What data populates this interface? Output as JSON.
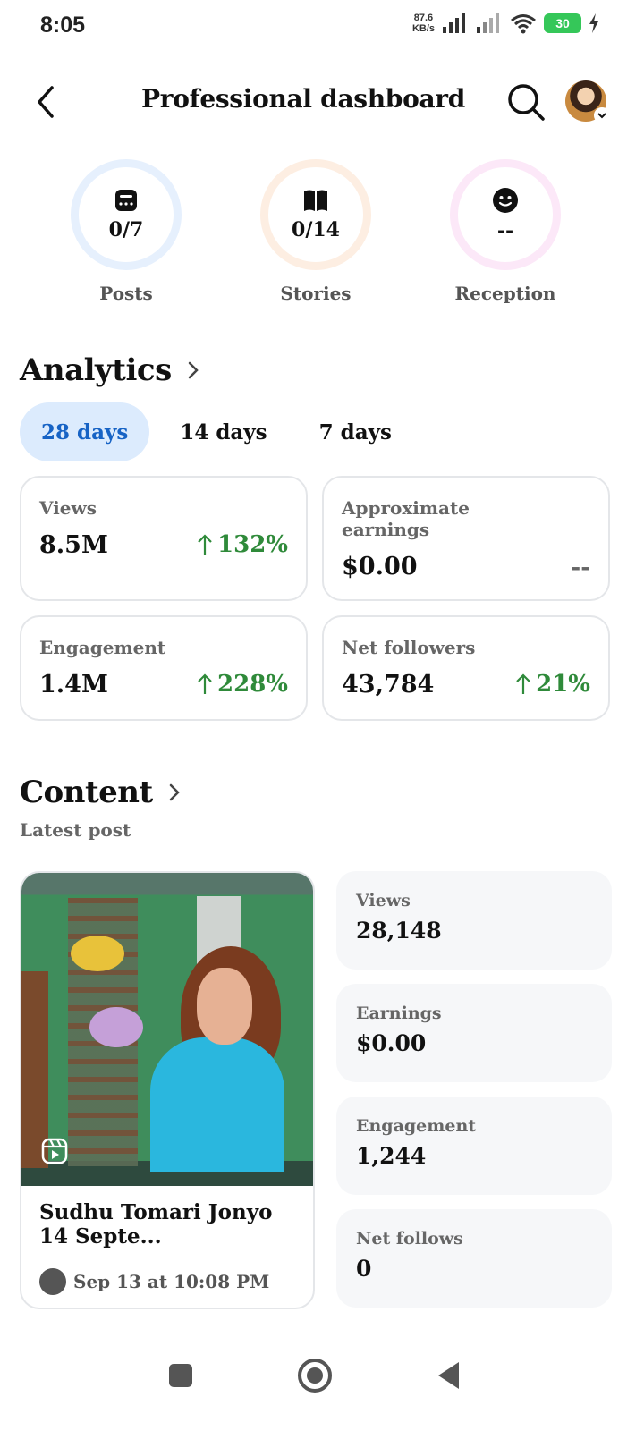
{
  "status_bar": {
    "time": "8:05",
    "net_speed_value": "87.6",
    "net_speed_unit": "KB/s",
    "battery": "30"
  },
  "header": {
    "title": "Professional dashboard"
  },
  "goals": [
    {
      "value": "0/7",
      "label": "Posts",
      "ring_color": "#e6f0fd",
      "icon": "post-icon"
    },
    {
      "value": "0/14",
      "label": "Stories",
      "ring_color": "#fdeee2",
      "icon": "book-icon"
    },
    {
      "value": "--",
      "label": "Reception",
      "ring_color": "#fce8f8",
      "icon": "smiley-icon"
    }
  ],
  "analytics": {
    "title": "Analytics",
    "ranges": [
      "28 days",
      "14 days",
      "7 days"
    ],
    "active_range": "28 days",
    "cards": [
      {
        "label": "Views",
        "value": "8.5M",
        "change": "132%"
      },
      {
        "label": "Approximate earnings",
        "value": "$0.00",
        "change": "--"
      },
      {
        "label": "Engagement",
        "value": "1.4M",
        "change": "228%"
      },
      {
        "label": "Net followers",
        "value": "43,784",
        "change": "21%"
      }
    ],
    "accent_color": "#1763c5",
    "positive_color": "#2f8a3a"
  },
  "content": {
    "title": "Content",
    "latest_label": "Latest post",
    "post": {
      "title": "Sudhu Tomari Jonyo 14 Septe...",
      "date": "Sep 13 at 10:08 PM"
    },
    "stats": [
      {
        "label": "Views",
        "value": "28,148"
      },
      {
        "label": "Earnings",
        "value": "$0.00"
      },
      {
        "label": "Engagement",
        "value": "1,244"
      },
      {
        "label": "Net follows",
        "value": "0"
      }
    ]
  }
}
